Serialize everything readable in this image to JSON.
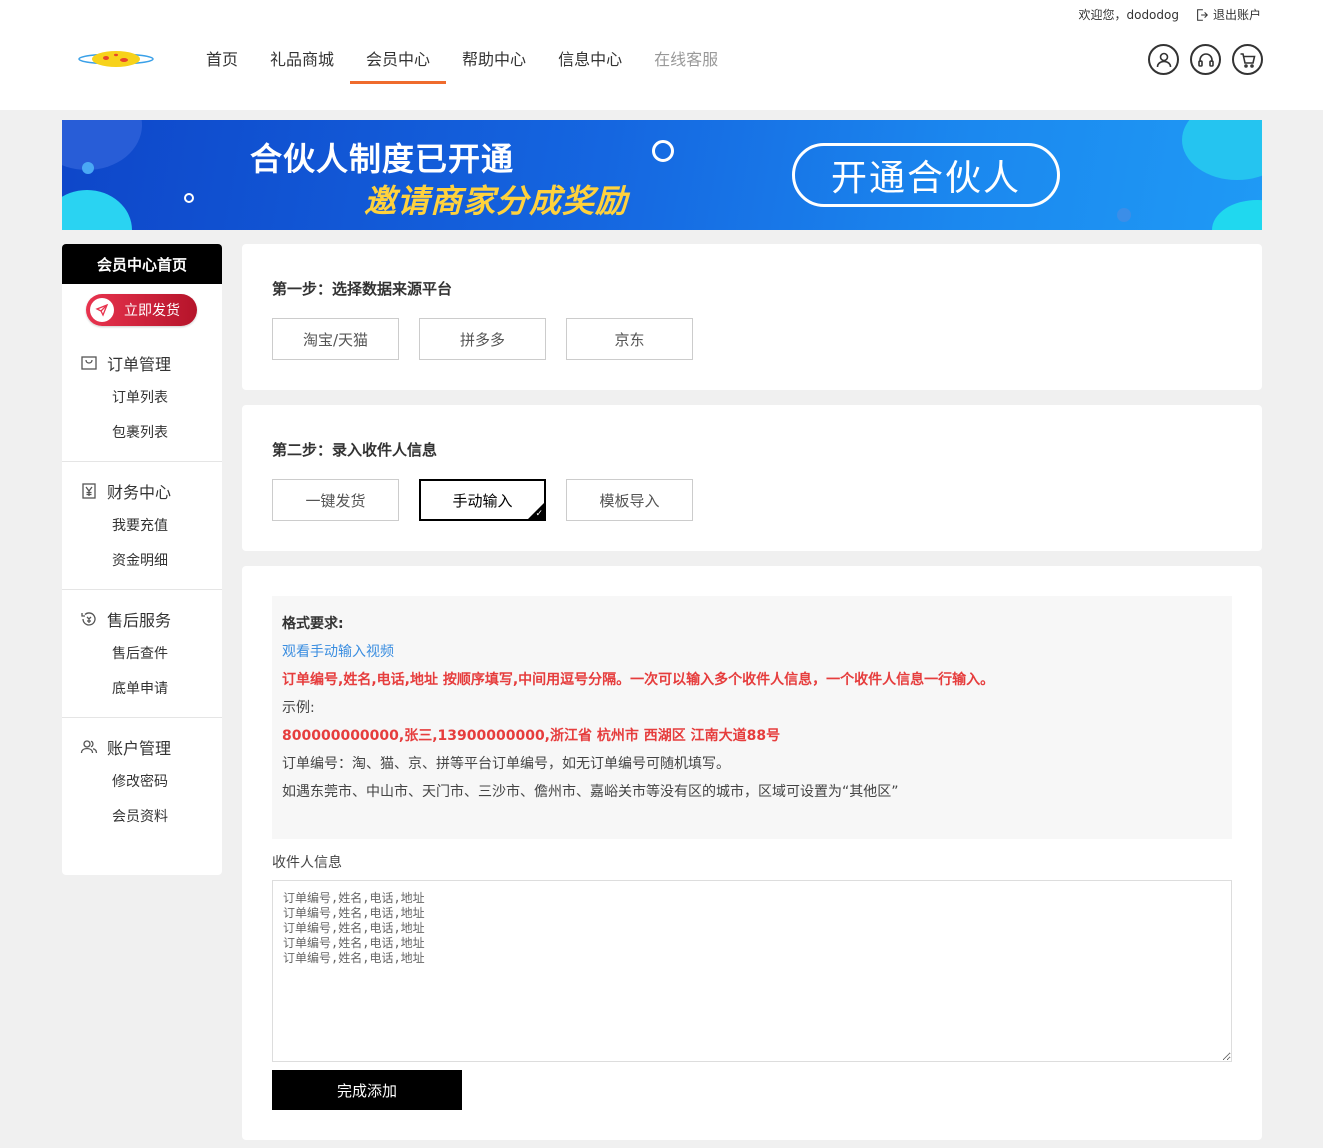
{
  "topbar": {
    "welcome": "欢迎您，dododog",
    "logout": "退出账户"
  },
  "nav": {
    "items": [
      {
        "label": "首页"
      },
      {
        "label": "礼品商城"
      },
      {
        "label": "会员中心"
      },
      {
        "label": "帮助中心"
      },
      {
        "label": "信息中心"
      },
      {
        "label": "在线客服"
      }
    ],
    "active": "会员中心",
    "accent_color": "#ef6b2d"
  },
  "header_icons": [
    "user-icon",
    "headset-icon",
    "cart-icon"
  ],
  "banner": {
    "line1": "合伙人制度已开通",
    "line2": "邀请商家分成奖励",
    "button": "开通合伙人"
  },
  "sidebar": {
    "title": "会员中心首页",
    "ship_button": "立即发货",
    "groups": [
      {
        "title": "订单管理",
        "icon": "bag-icon",
        "links": [
          "订单列表",
          "包裹列表"
        ]
      },
      {
        "title": "财务中心",
        "icon": "yen-icon",
        "links": [
          "我要充值",
          "资金明细"
        ]
      },
      {
        "title": "售后服务",
        "icon": "refund-icon",
        "links": [
          "售后查件",
          "底单申请"
        ]
      },
      {
        "title": "账户管理",
        "icon": "users-icon",
        "links": [
          "修改密码",
          "会员资料"
        ]
      }
    ]
  },
  "step1": {
    "title": "第一步：选择数据来源平台",
    "options": [
      "淘宝/天猫",
      "拼多多",
      "京东"
    ]
  },
  "step2": {
    "title": "第二步：录入收件人信息",
    "options": [
      "一键发货",
      "手动输入",
      "模板导入"
    ],
    "selected": "手动输入"
  },
  "format": {
    "heading": "格式要求:",
    "video_link": "观看手动输入视频",
    "rule": "订单编号,姓名,电话,地址 按顺序填写,中间用逗号分隔。一次可以输入多个收件人信息，一个收件人信息一行输入。",
    "example_label": "示例:",
    "example": "800000000000,张三,13900000000,浙江省 杭州市 西湖区 江南大道88号",
    "note1": "订单编号：淘、猫、京、拼等平台订单编号，如无订单编号可随机填写。",
    "note2": "如遇东莞市、中山市、天门市、三沙市、儋州市、嘉峪关市等没有区的城市，区域可设置为“其他区”"
  },
  "recipient": {
    "label": "收件人信息",
    "placeholder": "订单编号,姓名,电话,地址\n订单编号,姓名,电话,地址\n订单编号,姓名,电话,地址\n订单编号,姓名,电话,地址\n订单编号,姓名,电话,地址",
    "submit": "完成添加"
  }
}
